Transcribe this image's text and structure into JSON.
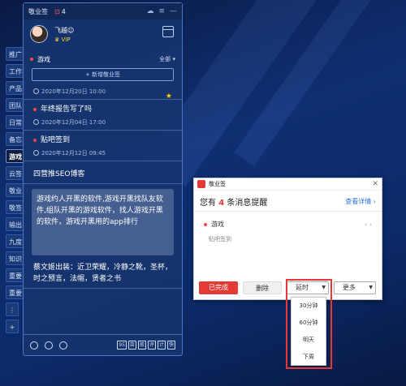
{
  "app": {
    "title": "敬业签",
    "unread_count": "4",
    "username": "飞越☺",
    "vip": "VIP"
  },
  "tabs": [
    "推广",
    "工作",
    "产品",
    "团队",
    "日常",
    "备忘",
    "游戏",
    "云签",
    "敬业",
    "敬签",
    "输出",
    "九度",
    "知识",
    "重要",
    "重要"
  ],
  "section": {
    "title": "游戏",
    "filter": "全部 ▾",
    "new_note": "+ 新增敬业签"
  },
  "notes": [
    {
      "title": "",
      "date": "2020年12月20日 10:00",
      "starred": true
    },
    {
      "title": "年终报告写了吗",
      "date": "2020年12月04日 17:00"
    },
    {
      "title": "贴吧签到",
      "date": "2020年12月12日 09:45"
    },
    {
      "title": "四营推SEO博客",
      "date": ""
    }
  ],
  "focused_note": "游戏约人开黑的软件,游戏开黑找队友软件,组队开黑的游戏软件，找人游戏开黑的软件，游戏开黑用的app排行",
  "last_note": "蔡文姬出装：近卫荣耀，冷静之靴，圣杯，时之预言，法帽，贤者之书",
  "bottom_bar": {
    "icons": [
      "contacts-icon",
      "search-icon",
      "settings-icon"
    ],
    "formats": [
      "95",
      "亩",
      "般",
      "评",
      "计",
      "快"
    ]
  },
  "popup": {
    "app_name": "敬业签",
    "headline_pre": "您有",
    "headline_num": "4",
    "headline_post": "条消息提醒",
    "details": "查看详情 ›",
    "item_title": "游戏",
    "item_sub": "贴吧签到",
    "done": "已完成",
    "delete": "删除",
    "delay": "延时",
    "more": "更多"
  },
  "dropdown_options": [
    "30分钟",
    "60分钟",
    "明天",
    "下周"
  ]
}
